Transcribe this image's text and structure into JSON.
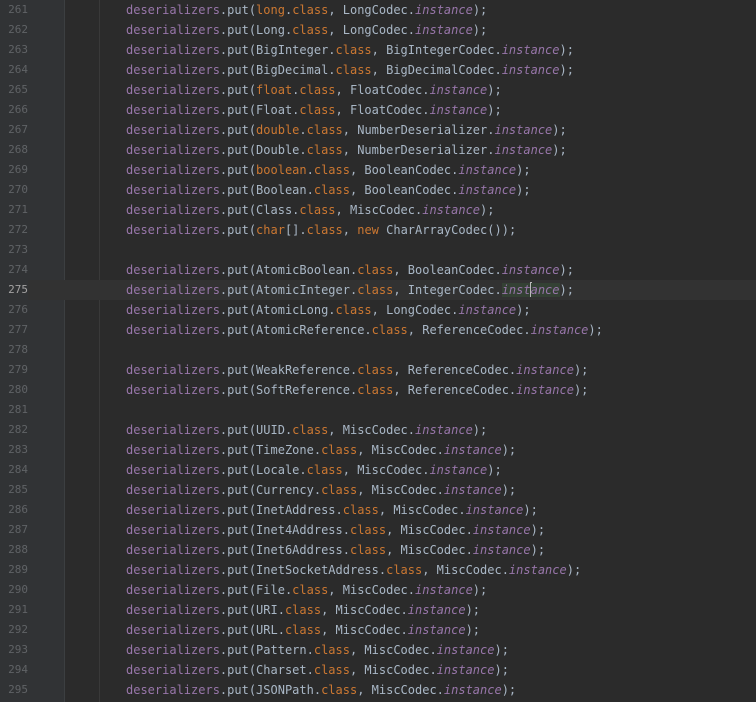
{
  "editor": {
    "current_line": "275",
    "lines": [
      {
        "n": "261",
        "tokens": [
          [
            "var",
            "deserializers"
          ],
          [
            "plain",
            ".put("
          ],
          [
            "kw",
            "long"
          ],
          [
            "plain",
            "."
          ],
          [
            "kw",
            "class"
          ],
          [
            "plain",
            ", LongCodec."
          ],
          [
            "inst",
            "instance"
          ],
          [
            "plain",
            ");"
          ]
        ]
      },
      {
        "n": "262",
        "tokens": [
          [
            "var",
            "deserializers"
          ],
          [
            "plain",
            ".put(Long."
          ],
          [
            "kw",
            "class"
          ],
          [
            "plain",
            ", LongCodec."
          ],
          [
            "inst",
            "instance"
          ],
          [
            "plain",
            ");"
          ]
        ]
      },
      {
        "n": "263",
        "tokens": [
          [
            "var",
            "deserializers"
          ],
          [
            "plain",
            ".put(BigInteger."
          ],
          [
            "kw",
            "class"
          ],
          [
            "plain",
            ", BigIntegerCodec."
          ],
          [
            "inst",
            "instance"
          ],
          [
            "plain",
            ");"
          ]
        ]
      },
      {
        "n": "264",
        "tokens": [
          [
            "var",
            "deserializers"
          ],
          [
            "plain",
            ".put(BigDecimal."
          ],
          [
            "kw",
            "class"
          ],
          [
            "plain",
            ", BigDecimalCodec."
          ],
          [
            "inst",
            "instance"
          ],
          [
            "plain",
            ");"
          ]
        ]
      },
      {
        "n": "265",
        "tokens": [
          [
            "var",
            "deserializers"
          ],
          [
            "plain",
            ".put("
          ],
          [
            "kw",
            "float"
          ],
          [
            "plain",
            "."
          ],
          [
            "kw",
            "class"
          ],
          [
            "plain",
            ", FloatCodec."
          ],
          [
            "inst",
            "instance"
          ],
          [
            "plain",
            ");"
          ]
        ]
      },
      {
        "n": "266",
        "tokens": [
          [
            "var",
            "deserializers"
          ],
          [
            "plain",
            ".put(Float."
          ],
          [
            "kw",
            "class"
          ],
          [
            "plain",
            ", FloatCodec."
          ],
          [
            "inst",
            "instance"
          ],
          [
            "plain",
            ");"
          ]
        ]
      },
      {
        "n": "267",
        "tokens": [
          [
            "var",
            "deserializers"
          ],
          [
            "plain",
            ".put("
          ],
          [
            "kw",
            "double"
          ],
          [
            "plain",
            "."
          ],
          [
            "kw",
            "class"
          ],
          [
            "plain",
            ", NumberDeserializer."
          ],
          [
            "inst",
            "instance"
          ],
          [
            "plain",
            ");"
          ]
        ]
      },
      {
        "n": "268",
        "tokens": [
          [
            "var",
            "deserializers"
          ],
          [
            "plain",
            ".put(Double."
          ],
          [
            "kw",
            "class"
          ],
          [
            "plain",
            ", NumberDeserializer."
          ],
          [
            "inst",
            "instance"
          ],
          [
            "plain",
            ");"
          ]
        ]
      },
      {
        "n": "269",
        "tokens": [
          [
            "var",
            "deserializers"
          ],
          [
            "plain",
            ".put("
          ],
          [
            "kw",
            "boolean"
          ],
          [
            "plain",
            "."
          ],
          [
            "kw",
            "class"
          ],
          [
            "plain",
            ", BooleanCodec."
          ],
          [
            "inst",
            "instance"
          ],
          [
            "plain",
            ");"
          ]
        ]
      },
      {
        "n": "270",
        "tokens": [
          [
            "var",
            "deserializers"
          ],
          [
            "plain",
            ".put(Boolean."
          ],
          [
            "kw",
            "class"
          ],
          [
            "plain",
            ", BooleanCodec."
          ],
          [
            "inst",
            "instance"
          ],
          [
            "plain",
            ");"
          ]
        ]
      },
      {
        "n": "271",
        "tokens": [
          [
            "var",
            "deserializers"
          ],
          [
            "plain",
            ".put(Class."
          ],
          [
            "kw",
            "class"
          ],
          [
            "plain",
            ", MiscCodec."
          ],
          [
            "inst",
            "instance"
          ],
          [
            "plain",
            ");"
          ]
        ]
      },
      {
        "n": "272",
        "tokens": [
          [
            "var",
            "deserializers"
          ],
          [
            "plain",
            ".put("
          ],
          [
            "kw",
            "char"
          ],
          [
            "plain",
            "[]."
          ],
          [
            "kw",
            "class"
          ],
          [
            "plain",
            ", "
          ],
          [
            "kw",
            "new"
          ],
          [
            "plain",
            " CharArrayCodec());"
          ]
        ]
      },
      {
        "n": "273",
        "tokens": []
      },
      {
        "n": "274",
        "tokens": [
          [
            "var",
            "deserializers"
          ],
          [
            "plain",
            ".put(AtomicBoolean."
          ],
          [
            "kw",
            "class"
          ],
          [
            "plain",
            ", BooleanCodec."
          ],
          [
            "inst",
            "instance"
          ],
          [
            "plain",
            ");"
          ]
        ]
      },
      {
        "n": "275",
        "tokens": [
          [
            "var",
            "deserializers"
          ],
          [
            "plain",
            ".put(AtomicInteger."
          ],
          [
            "kw",
            "class"
          ],
          [
            "plain",
            ", IntegerCodec."
          ],
          [
            "insthl",
            "inst"
          ],
          [
            "caret",
            ""
          ],
          [
            "insthl",
            "ance"
          ],
          [
            "plain",
            ");"
          ]
        ]
      },
      {
        "n": "276",
        "tokens": [
          [
            "var",
            "deserializers"
          ],
          [
            "plain",
            ".put(AtomicLong."
          ],
          [
            "kw",
            "class"
          ],
          [
            "plain",
            ", LongCodec."
          ],
          [
            "inst",
            "instance"
          ],
          [
            "plain",
            ");"
          ]
        ]
      },
      {
        "n": "277",
        "tokens": [
          [
            "var",
            "deserializers"
          ],
          [
            "plain",
            ".put(AtomicReference."
          ],
          [
            "kw",
            "class"
          ],
          [
            "plain",
            ", ReferenceCodec."
          ],
          [
            "inst",
            "instance"
          ],
          [
            "plain",
            ");"
          ]
        ]
      },
      {
        "n": "278",
        "tokens": []
      },
      {
        "n": "279",
        "tokens": [
          [
            "var",
            "deserializers"
          ],
          [
            "plain",
            ".put(WeakReference."
          ],
          [
            "kw",
            "class"
          ],
          [
            "plain",
            ", ReferenceCodec."
          ],
          [
            "inst",
            "instance"
          ],
          [
            "plain",
            ");"
          ]
        ]
      },
      {
        "n": "280",
        "tokens": [
          [
            "var",
            "deserializers"
          ],
          [
            "plain",
            ".put(SoftReference."
          ],
          [
            "kw",
            "class"
          ],
          [
            "plain",
            ", ReferenceCodec."
          ],
          [
            "inst",
            "instance"
          ],
          [
            "plain",
            ");"
          ]
        ]
      },
      {
        "n": "281",
        "tokens": []
      },
      {
        "n": "282",
        "tokens": [
          [
            "var",
            "deserializers"
          ],
          [
            "plain",
            ".put(UUID."
          ],
          [
            "kw",
            "class"
          ],
          [
            "plain",
            ", MiscCodec."
          ],
          [
            "inst",
            "instance"
          ],
          [
            "plain",
            ");"
          ]
        ]
      },
      {
        "n": "283",
        "tokens": [
          [
            "var",
            "deserializers"
          ],
          [
            "plain",
            ".put(TimeZone."
          ],
          [
            "kw",
            "class"
          ],
          [
            "plain",
            ", MiscCodec."
          ],
          [
            "inst",
            "instance"
          ],
          [
            "plain",
            ");"
          ]
        ]
      },
      {
        "n": "284",
        "tokens": [
          [
            "var",
            "deserializers"
          ],
          [
            "plain",
            ".put(Locale."
          ],
          [
            "kw",
            "class"
          ],
          [
            "plain",
            ", MiscCodec."
          ],
          [
            "inst",
            "instance"
          ],
          [
            "plain",
            ");"
          ]
        ]
      },
      {
        "n": "285",
        "tokens": [
          [
            "var",
            "deserializers"
          ],
          [
            "plain",
            ".put(Currency."
          ],
          [
            "kw",
            "class"
          ],
          [
            "plain",
            ", MiscCodec."
          ],
          [
            "inst",
            "instance"
          ],
          [
            "plain",
            ");"
          ]
        ]
      },
      {
        "n": "286",
        "tokens": [
          [
            "var",
            "deserializers"
          ],
          [
            "plain",
            ".put(InetAddress."
          ],
          [
            "kw",
            "class"
          ],
          [
            "plain",
            ", MiscCodec."
          ],
          [
            "inst",
            "instance"
          ],
          [
            "plain",
            ");"
          ]
        ]
      },
      {
        "n": "287",
        "tokens": [
          [
            "var",
            "deserializers"
          ],
          [
            "plain",
            ".put(Inet4Address."
          ],
          [
            "kw",
            "class"
          ],
          [
            "plain",
            ", MiscCodec."
          ],
          [
            "inst",
            "instance"
          ],
          [
            "plain",
            ");"
          ]
        ]
      },
      {
        "n": "288",
        "tokens": [
          [
            "var",
            "deserializers"
          ],
          [
            "plain",
            ".put(Inet6Address."
          ],
          [
            "kw",
            "class"
          ],
          [
            "plain",
            ", MiscCodec."
          ],
          [
            "inst",
            "instance"
          ],
          [
            "plain",
            ");"
          ]
        ]
      },
      {
        "n": "289",
        "tokens": [
          [
            "var",
            "deserializers"
          ],
          [
            "plain",
            ".put(InetSocketAddress."
          ],
          [
            "kw",
            "class"
          ],
          [
            "plain",
            ", MiscCodec."
          ],
          [
            "inst",
            "instance"
          ],
          [
            "plain",
            ");"
          ]
        ]
      },
      {
        "n": "290",
        "tokens": [
          [
            "var",
            "deserializers"
          ],
          [
            "plain",
            ".put(File."
          ],
          [
            "kw",
            "class"
          ],
          [
            "plain",
            ", MiscCodec."
          ],
          [
            "inst",
            "instance"
          ],
          [
            "plain",
            ");"
          ]
        ]
      },
      {
        "n": "291",
        "tokens": [
          [
            "var",
            "deserializers"
          ],
          [
            "plain",
            ".put(URI."
          ],
          [
            "kw",
            "class"
          ],
          [
            "plain",
            ", MiscCodec."
          ],
          [
            "inst",
            "instance"
          ],
          [
            "plain",
            ");"
          ]
        ]
      },
      {
        "n": "292",
        "tokens": [
          [
            "var",
            "deserializers"
          ],
          [
            "plain",
            ".put(URL."
          ],
          [
            "kw",
            "class"
          ],
          [
            "plain",
            ", MiscCodec."
          ],
          [
            "inst",
            "instance"
          ],
          [
            "plain",
            ");"
          ]
        ]
      },
      {
        "n": "293",
        "tokens": [
          [
            "var",
            "deserializers"
          ],
          [
            "plain",
            ".put(Pattern."
          ],
          [
            "kw",
            "class"
          ],
          [
            "plain",
            ", MiscCodec."
          ],
          [
            "inst",
            "instance"
          ],
          [
            "plain",
            ");"
          ]
        ]
      },
      {
        "n": "294",
        "tokens": [
          [
            "var",
            "deserializers"
          ],
          [
            "plain",
            ".put(Charset."
          ],
          [
            "kw",
            "class"
          ],
          [
            "plain",
            ", MiscCodec."
          ],
          [
            "inst",
            "instance"
          ],
          [
            "plain",
            ");"
          ]
        ]
      },
      {
        "n": "295",
        "tokens": [
          [
            "var",
            "deserializers"
          ],
          [
            "plain",
            ".put(JSONPath."
          ],
          [
            "kw",
            "class"
          ],
          [
            "plain",
            ", MiscCodec."
          ],
          [
            "inst",
            "instance"
          ],
          [
            "plain",
            ");"
          ]
        ]
      }
    ]
  }
}
